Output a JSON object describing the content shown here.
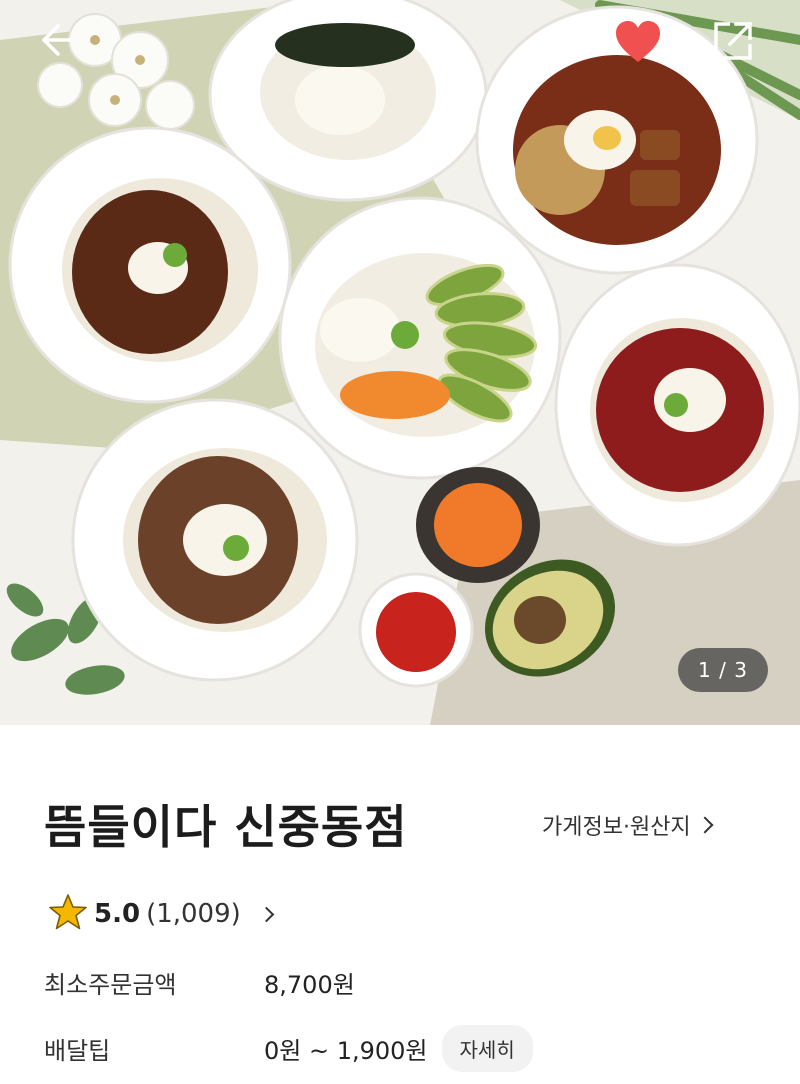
{
  "hero": {
    "page_current": "1",
    "page_total": "3",
    "page_indicator": "1 / 3"
  },
  "icons": {
    "back": "arrow-left-icon",
    "favorite": "heart-icon",
    "share": "share-icon",
    "rating": "star-icon"
  },
  "colors": {
    "heart": "#f0504f",
    "star": "#f5b800",
    "overlay": "#3c3c3c"
  },
  "store": {
    "name": "뜸들이다 신중동점",
    "info_link": "가게정보·원산지"
  },
  "rating": {
    "score": "5.0",
    "count": "(1,009)"
  },
  "min_order": {
    "label": "최소주문금액",
    "value": "8,700원"
  },
  "delivery_tip": {
    "label": "배달팁",
    "value": "0원 ~ 1,900원",
    "detail_button": "자세히"
  }
}
